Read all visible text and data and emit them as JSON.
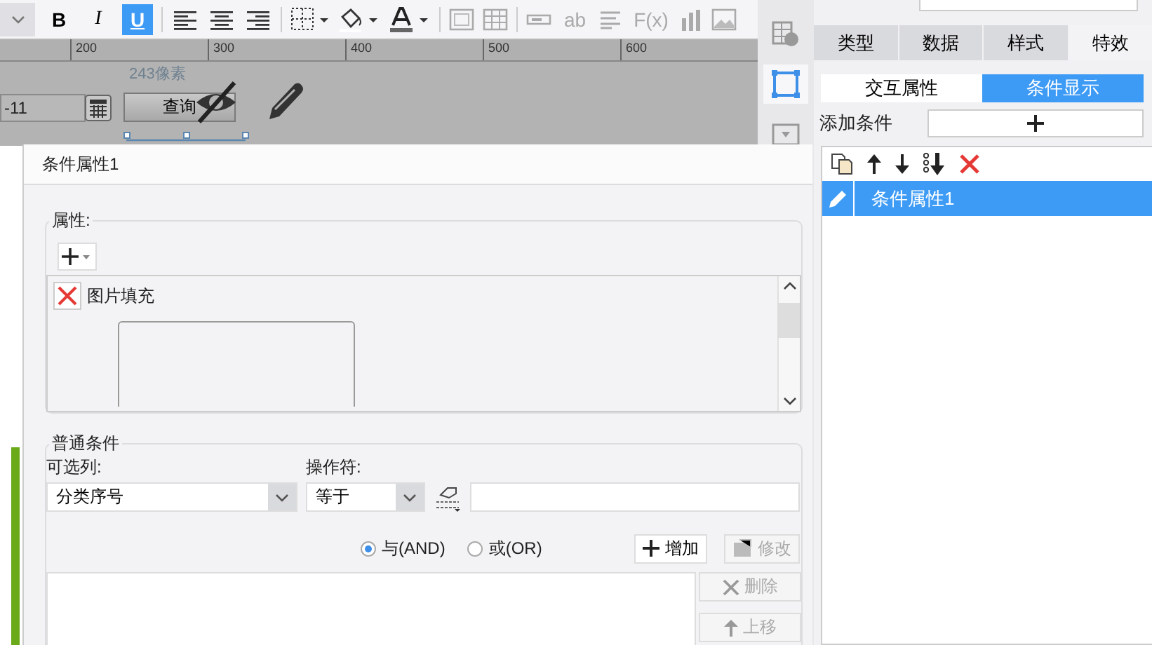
{
  "toolbar": {
    "format_buttons": [
      {
        "label": "B",
        "selected": false
      },
      {
        "label": "I",
        "selected": false
      },
      {
        "label": "U",
        "selected": true
      }
    ],
    "text_tools": [
      {
        "label": "ab"
      },
      {
        "label": "F(x)"
      }
    ]
  },
  "ruler": {
    "labels": [
      "200",
      "300",
      "400",
      "500",
      "600"
    ]
  },
  "canvas": {
    "size_hint": "243像素",
    "date_value": "-11",
    "query_button": "查询"
  },
  "dialog": {
    "title": "条件属性1",
    "properties": {
      "legend": "属性:",
      "items": [
        {
          "label": "图片填充"
        }
      ]
    },
    "conditions": {
      "legend": "普通条件",
      "column_label": "可选列:",
      "column_value": "分类序号",
      "operator_label": "操作符:",
      "operator_value": "等于",
      "logic": [
        {
          "label": "与(AND)",
          "selected": true
        },
        {
          "label": "或(OR)",
          "selected": false
        }
      ],
      "buttons": [
        {
          "label": "增加",
          "kind": "add",
          "disabled": false
        },
        {
          "label": "修改",
          "kind": "edit",
          "disabled": true
        },
        {
          "label": "删除",
          "kind": "delete",
          "disabled": true
        },
        {
          "label": "上移",
          "kind": "up",
          "disabled": true
        }
      ]
    }
  },
  "side_panel": {
    "tabs": [
      {
        "label": "类型",
        "selected": false
      },
      {
        "label": "数据",
        "selected": false
      },
      {
        "label": "样式",
        "selected": false
      },
      {
        "label": "特效",
        "selected": true
      }
    ],
    "subtabs": [
      {
        "label": "交互属性",
        "selected": false
      },
      {
        "label": "条件显示",
        "selected": true
      }
    ],
    "add_label": "添加条件",
    "list": [
      {
        "label": "条件属性1",
        "selected": true
      }
    ]
  }
}
